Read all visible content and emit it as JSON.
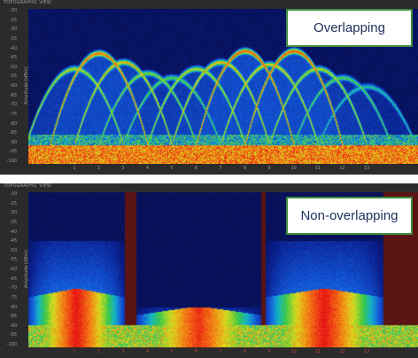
{
  "panels": [
    {
      "title": "TOPOGRAPHIC VIEW",
      "annotation": "Overlapping",
      "ylabel": "Amplitude [dBm]",
      "yticks": [
        "-20",
        "-25",
        "-30",
        "-35",
        "-40",
        "-45",
        "-50",
        "-55",
        "-60",
        "-65",
        "-70",
        "-75",
        "-80",
        "-85",
        "-90",
        "-95",
        "-100"
      ],
      "xticks": [
        "1",
        "2",
        "3",
        "4",
        "5",
        "6",
        "7",
        "8",
        "9",
        "10",
        "11",
        "12",
        "13"
      ],
      "channel_centers": [
        1,
        2,
        3,
        4,
        5,
        6,
        7,
        8,
        9,
        10,
        11,
        12,
        13
      ],
      "channel_strength": [
        0.55,
        0.9,
        0.7,
        0.45,
        0.35,
        0.55,
        0.7,
        0.95,
        0.65,
        0.95,
        0.55,
        0.35,
        0.15
      ]
    },
    {
      "title": "TOPOGRAPHIC VIEW",
      "annotation": "Non-overlapping",
      "ylabel": "Amplitude [dBm]",
      "yticks": [
        "-20",
        "-25",
        "-30",
        "-35",
        "-40",
        "-45",
        "-50",
        "-55",
        "-60",
        "-65",
        "-70",
        "-75",
        "-80",
        "-85",
        "-90",
        "-95",
        "-100"
      ],
      "xticks": [
        "1",
        "2",
        "3",
        "4",
        "5",
        "6",
        "7",
        "8",
        "9",
        "10",
        "11",
        "12",
        "13"
      ],
      "channel_centers": [
        1.5,
        6,
        10.5
      ],
      "channel_strength": [
        0.95,
        0.85,
        0.95
      ]
    }
  ],
  "colors": {
    "panel_bg": "#2b2b2b",
    "plot_bg": "#0a1040",
    "nonoverlap_bg": "#5a1414",
    "annotation_border": "#3f8c3f",
    "annotation_text": "#1f2f5c"
  }
}
